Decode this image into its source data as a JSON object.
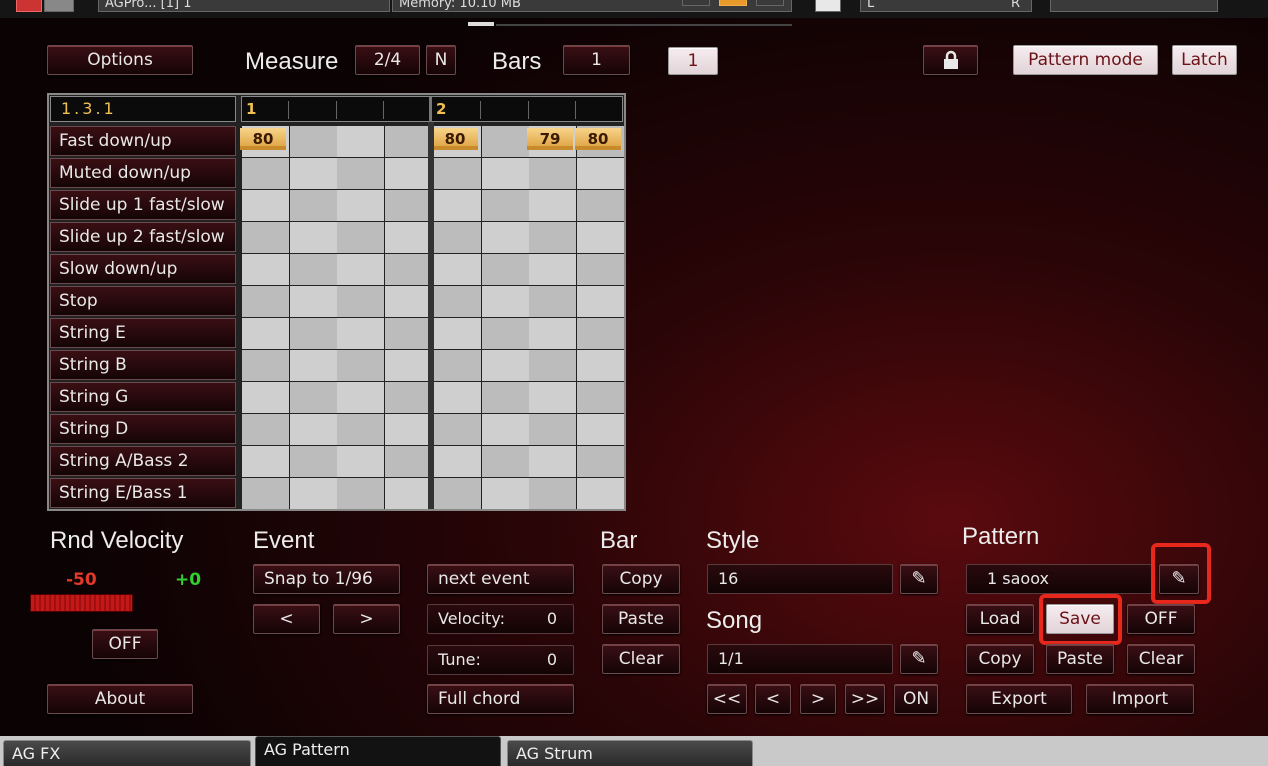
{
  "topbar": {
    "instrument": "AGPro... [1] 1",
    "memory": "Memory: 10.10 MB",
    "pan_left": "L",
    "pan_right": "R"
  },
  "header": {
    "options": "Options",
    "measure_label": "Measure",
    "measure_value": "2/4",
    "measure_n": "N",
    "bars_label": "Bars",
    "bars_value": "1",
    "page_value": "1",
    "lock_icon": "lock-icon",
    "pattern_mode": "Pattern mode",
    "latch": "Latch"
  },
  "grid": {
    "position": "1.3.1",
    "bar_numbers": [
      "1",
      "2"
    ],
    "rows": [
      "Fast down/up",
      "Muted down/up",
      "Slide up 1 fast/slow",
      "Slide up 2 fast/slow",
      "Slow down/up",
      "Stop",
      "String E",
      "String B",
      "String G",
      "String D",
      "String A/Bass 2",
      "String E/Bass 1"
    ],
    "velocities": [
      "80",
      "80",
      "79",
      "80"
    ]
  },
  "rnd_velocity": {
    "title": "Rnd Velocity",
    "min": "-50",
    "max": "+0",
    "off": "OFF",
    "about": "About"
  },
  "event": {
    "title": "Event",
    "snap": "Snap to 1/96",
    "prev": "<",
    "next": ">",
    "next_event": "next event",
    "velocity_label": "Velocity:",
    "velocity_value": "0",
    "tune_label": "Tune:",
    "tune_value": "0",
    "full_chord": "Full chord"
  },
  "bar": {
    "title": "Bar",
    "copy": "Copy",
    "paste": "Paste",
    "clear": "Clear"
  },
  "style": {
    "title": "Style",
    "value": "16"
  },
  "song": {
    "title": "Song",
    "value": "1/1",
    "first": "<<",
    "prev": "<",
    "next": ">",
    "last": ">>",
    "on": "ON"
  },
  "pattern": {
    "title": "Pattern",
    "name": "1 saoox",
    "load": "Load",
    "save": "Save",
    "off": "OFF",
    "copy": "Copy",
    "paste": "Paste",
    "clear": "Clear",
    "export": "Export",
    "import": "Import"
  },
  "tabs": [
    "AG FX",
    "AG Pattern",
    "AG Strum"
  ]
}
